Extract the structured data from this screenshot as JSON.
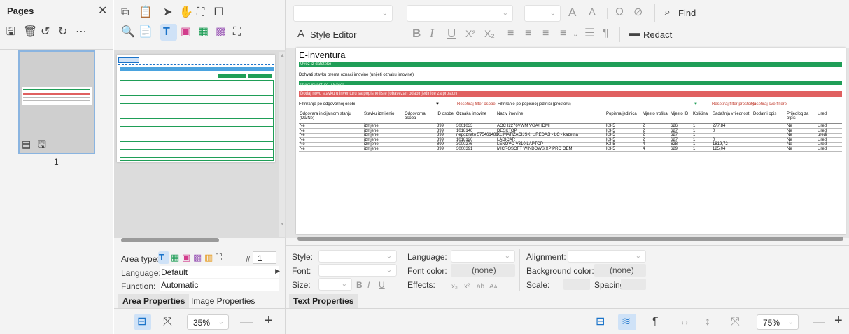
{
  "pages_panel": {
    "title": "Pages",
    "page_number": "1"
  },
  "center_panel": {
    "area_type_label": "Area type:",
    "area_number_symbol": "#",
    "area_number_value": "1",
    "language_label": "Language:",
    "language_value": "Default",
    "function_label": "Function:",
    "function_value": "Automatic",
    "tabs": [
      "Area Properties",
      "Image Properties"
    ],
    "zoom_value": "35%"
  },
  "toolbar": {
    "style_editor_label": "Style Editor",
    "find_label": "Find",
    "redact_label": "Redact"
  },
  "text_properties": {
    "style_label": "Style:",
    "font_label": "Font:",
    "size_label": "Size:",
    "language_label": "Language:",
    "font_color_label": "Font color:",
    "font_color_value": "(none)",
    "effects_label": "Effects:",
    "alignment_label": "Alignment:",
    "background_color_label": "Background color:",
    "background_color_value": "(none)",
    "scale_label": "Scale:",
    "spacing_label": "Spacing:",
    "tab_label": "Text Properties",
    "zoom_value": "75%"
  },
  "document": {
    "title": "E-inventura",
    "green_bar_1": "Uvoz iz datoteke",
    "dohvati_text": "Dohvati stavku prema oznaci imovine (unijeti oznaku imovine)",
    "green_bar_2": "Izvoz inventure u Excel",
    "red_bar": "Dodaj novu stavku u inventuru sa popisne liste (obavezan odabir jedinice za prostor)",
    "filter_left": "Filtriranje po odgovornoj osobi",
    "filter_right": "Filtriranje po popisnoj jedinici (prostoru)",
    "filter_link_1": "Resetiraj filter osobe",
    "filter_link_2": "Resetiraj filter prostorija",
    "filter_link_3": "Resetiraj sve filtere",
    "columns": [
      "Odgovara inicijalnom stanju (Da/Ne)",
      "Stavku izmijenio",
      "Odgovorna osoba",
      "ID osobe",
      "Oznaka imovine",
      "Naziv imovine",
      "Popisna jedinica",
      "Mjesto troška",
      "Mjesto ID",
      "Količina",
      "Sadašnja vrijednost",
      "Dodatni opis",
      "Prijedlog za otpis",
      "Uredi"
    ],
    "rows": [
      [
        "Ne",
        "izmjene",
        "",
        "899",
        "3001033",
        "AOC I2276VWM VGA/HDMI",
        "K3-5",
        "2",
        "626",
        "1",
        "277,84",
        "",
        "Ne",
        "Uredi"
      ],
      [
        "Ne",
        "izmjene",
        "",
        "899",
        "1018146",
        "DESKTOP",
        "K3-5",
        "2",
        "627",
        "1",
        "0",
        "",
        "Ne",
        "Uredi"
      ],
      [
        "Ne",
        "izmjene",
        "",
        "899",
        "nepoznato 575461486",
        "KLIMATIZACIJSKI UREĐAJI - LC - kazetna",
        "K3-5",
        "2",
        "627",
        "1",
        "",
        "",
        "Ne",
        "uredi"
      ],
      [
        "Ne",
        "izmjene",
        "",
        "899",
        "1018120",
        "LADICAR",
        "K3-5",
        "2",
        "627",
        "1",
        "0",
        "",
        "Ne",
        "Uredi"
      ],
      [
        "Ne",
        "izmjene",
        "",
        "899",
        "3000276",
        "LENOVO V310 LAPTOP",
        "K3-5",
        "4",
        "628",
        "1",
        "1819,72",
        "",
        "Ne",
        "Uredi"
      ],
      [
        "Ne",
        "izmjene",
        "",
        "899",
        "3000391",
        "MICROSOFT WINDOWS XP PRO OEM",
        "K3-5",
        "4",
        "629",
        "1",
        "125,04",
        "",
        "Ne",
        "Uredi"
      ]
    ]
  },
  "colors": {
    "accent_blue": "#1a73c9",
    "selection_bg": "#cfe2f7",
    "green_bar": "#1f9e57",
    "red_bar": "#e06060"
  }
}
